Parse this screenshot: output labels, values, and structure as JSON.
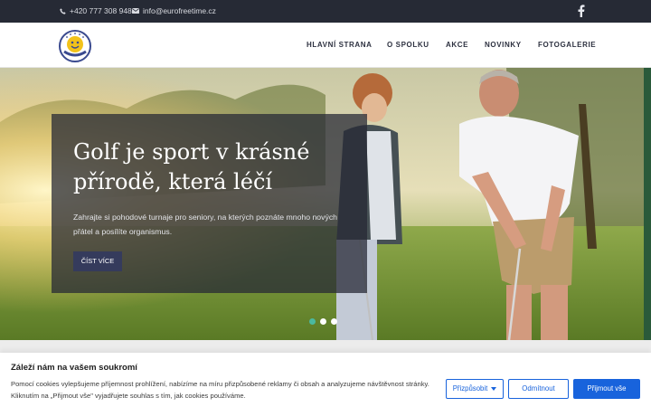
{
  "topbar": {
    "phone": "+420 777 308 948",
    "email": "info@eurofreetime.cz",
    "icons": [
      "phone-icon",
      "mail-icon",
      "facebook-icon"
    ]
  },
  "logo": {
    "text": "EUROFREETIME",
    "colors": {
      "ring": "#3a4a8f",
      "inner": "#f2c21a"
    }
  },
  "nav": {
    "items": [
      {
        "label": "HLAVNÍ STRANA"
      },
      {
        "label": "O SPOLKU"
      },
      {
        "label": "AKCE"
      },
      {
        "label": "NOVINKY"
      },
      {
        "label": "FOTOGALERIE"
      }
    ]
  },
  "hero": {
    "title": "Golf je sport v krásné přírodě, která léčí",
    "text": "Zahrajte si pohodové turnaje pro seniory, na kterých poznáte mnoho nových přátel a posílíte organismus.",
    "cta": "ČÍST VÍCE",
    "slides": 3,
    "active_slide": 1
  },
  "cookie": {
    "title": "Záleží nám na vašem soukromí",
    "text": "Pomocí cookies vylepšujeme příjemnost prohlížení, nabízíme na míru přizpůsobené reklamy či obsah a analyzujeme návštěvnost stránky. Kliknutím na „Přijmout vše\" vyjadřujete souhlas s tím, jak cookies používáme.",
    "customize": "Přizpůsobit",
    "reject": "Odmítnout",
    "accept": "Přijmout vše"
  },
  "colors": {
    "topbar": "#262a35",
    "accent": "#1863dc",
    "overlay": "#262834",
    "cta": "#353b5c",
    "active_dot": "#4bb89f"
  }
}
